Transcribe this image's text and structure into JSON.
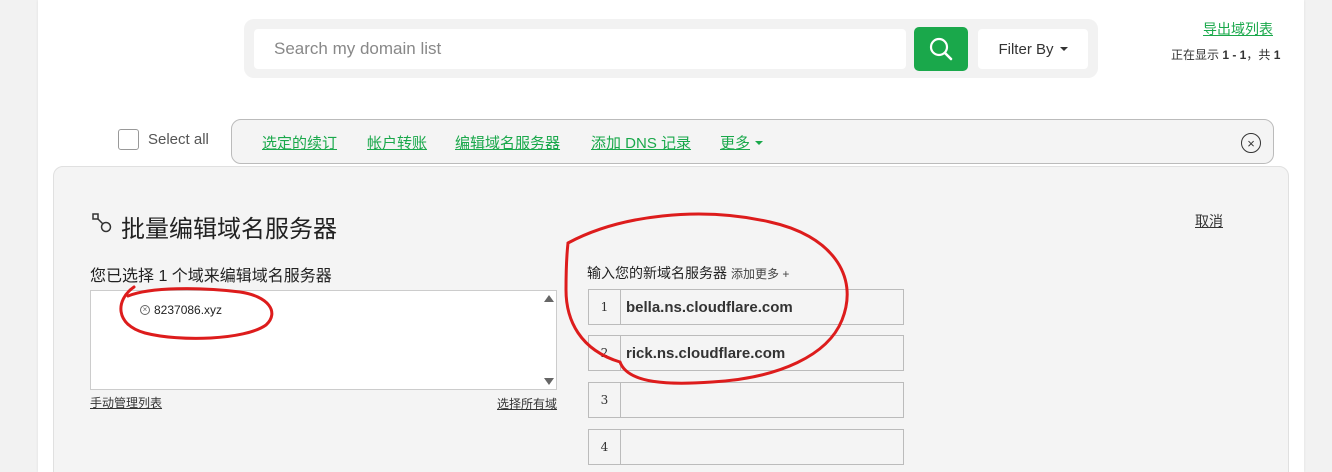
{
  "search": {
    "placeholder": "Search my domain list",
    "filter_label": "Filter By"
  },
  "header": {
    "export_label": "导出域列表",
    "showing_prefix": "正在显示 ",
    "showing_range": "1 - 1",
    "showing_mid": "，共 ",
    "showing_total": "1"
  },
  "toolbar": {
    "select_all_label": "Select all",
    "actions": [
      "选定的续订",
      "帐户转账",
      "编辑域名服务器",
      "添加 DNS 记录",
      "更多"
    ]
  },
  "panel": {
    "title": "批量编辑域名服务器",
    "cancel_label": "取消",
    "selected_label": "您已选择 1 个域来编辑域名服务器",
    "domains": [
      "8237086.xyz"
    ],
    "manual_label": "手动管理列表",
    "select_all_domains_label": "选择所有域",
    "ns_label": "输入您的新域名服务器",
    "ns_add_label": "添加更多 +",
    "nameservers": [
      {
        "num": "1",
        "value": "bella.ns.cloudflare.com"
      },
      {
        "num": "2",
        "value": "rick.ns.cloudflare.com"
      },
      {
        "num": "3",
        "value": ""
      },
      {
        "num": "4",
        "value": ""
      }
    ]
  },
  "colors": {
    "accent": "#1aa84b",
    "annotation": "#dd1c1c"
  },
  "icons": [
    "search-icon",
    "chevron-down-icon",
    "close-circle-icon",
    "nameserver-edit-icon",
    "remove-domain-icon"
  ]
}
